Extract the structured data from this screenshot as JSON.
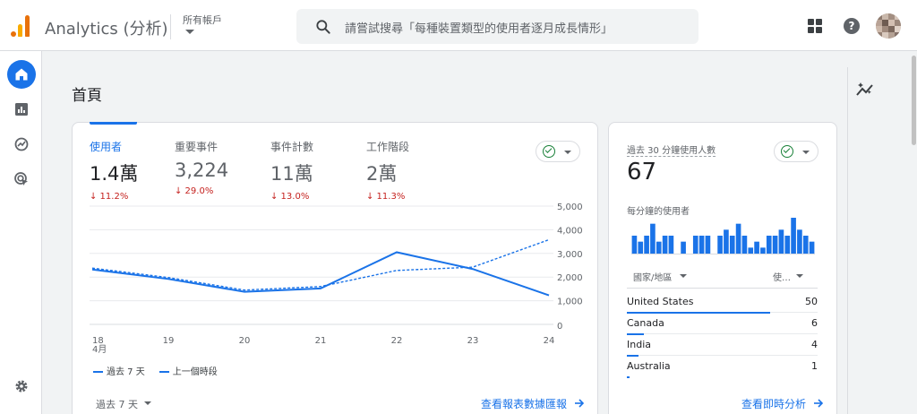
{
  "header": {
    "app_title": "Analytics (分析)",
    "account_label": "所有帳戶",
    "search_placeholder": "請嘗試搜尋「每種裝置類型的使用者逐月成長情形」",
    "help_label": "?"
  },
  "page": {
    "title": "首頁"
  },
  "metrics": [
    {
      "label": "使用者",
      "value": "1.4萬",
      "change": "↓ 11.2%"
    },
    {
      "label": "重要事件",
      "value": "3,224",
      "change": "↓ 29.0%"
    },
    {
      "label": "事件計數",
      "value": "11萬",
      "change": "↓ 13.0%"
    },
    {
      "label": "工作階段",
      "value": "2萬",
      "change": "↓ 11.3%"
    }
  ],
  "chart_data": {
    "type": "line",
    "x": [
      "18",
      "19",
      "20",
      "21",
      "22",
      "23",
      "24"
    ],
    "x_sublabel": "4月",
    "y_ticks": [
      "5,000",
      "4,000",
      "3,000",
      "2,000",
      "1,000",
      "0"
    ],
    "ylim": [
      0,
      5000
    ],
    "series": [
      {
        "name": "過去 7 天",
        "style": "solid",
        "values": [
          2320,
          1920,
          1380,
          1520,
          3050,
          2340,
          1230
        ]
      },
      {
        "name": "上一個時段",
        "style": "dashed",
        "values": [
          2380,
          1980,
          1450,
          1600,
          2280,
          2420,
          3580
        ]
      }
    ]
  },
  "footer_main": {
    "period": "過去 7 天",
    "link": "查看報表數據匯報"
  },
  "realtime": {
    "label": "過去 30 分鐘使用人數",
    "value": "67",
    "subtitle": "每分鐘的使用者",
    "minute_bars": [
      3,
      2,
      3,
      5,
      2,
      3,
      3,
      0,
      2,
      0,
      3,
      3,
      3,
      0,
      3,
      4,
      3,
      5,
      3,
      1,
      2,
      1,
      3,
      3,
      4,
      3,
      6,
      4,
      3,
      2
    ],
    "col_country": "國家/地區",
    "col_users": "使…",
    "rows": [
      {
        "country": "United States",
        "users": 50
      },
      {
        "country": "Canada",
        "users": 6
      },
      {
        "country": "India",
        "users": 4
      },
      {
        "country": "Australia",
        "users": 1
      }
    ],
    "link": "查看即時分析"
  },
  "colors": {
    "accent": "#1a73e8",
    "negative": "#c5221f",
    "positive": "#188038"
  }
}
